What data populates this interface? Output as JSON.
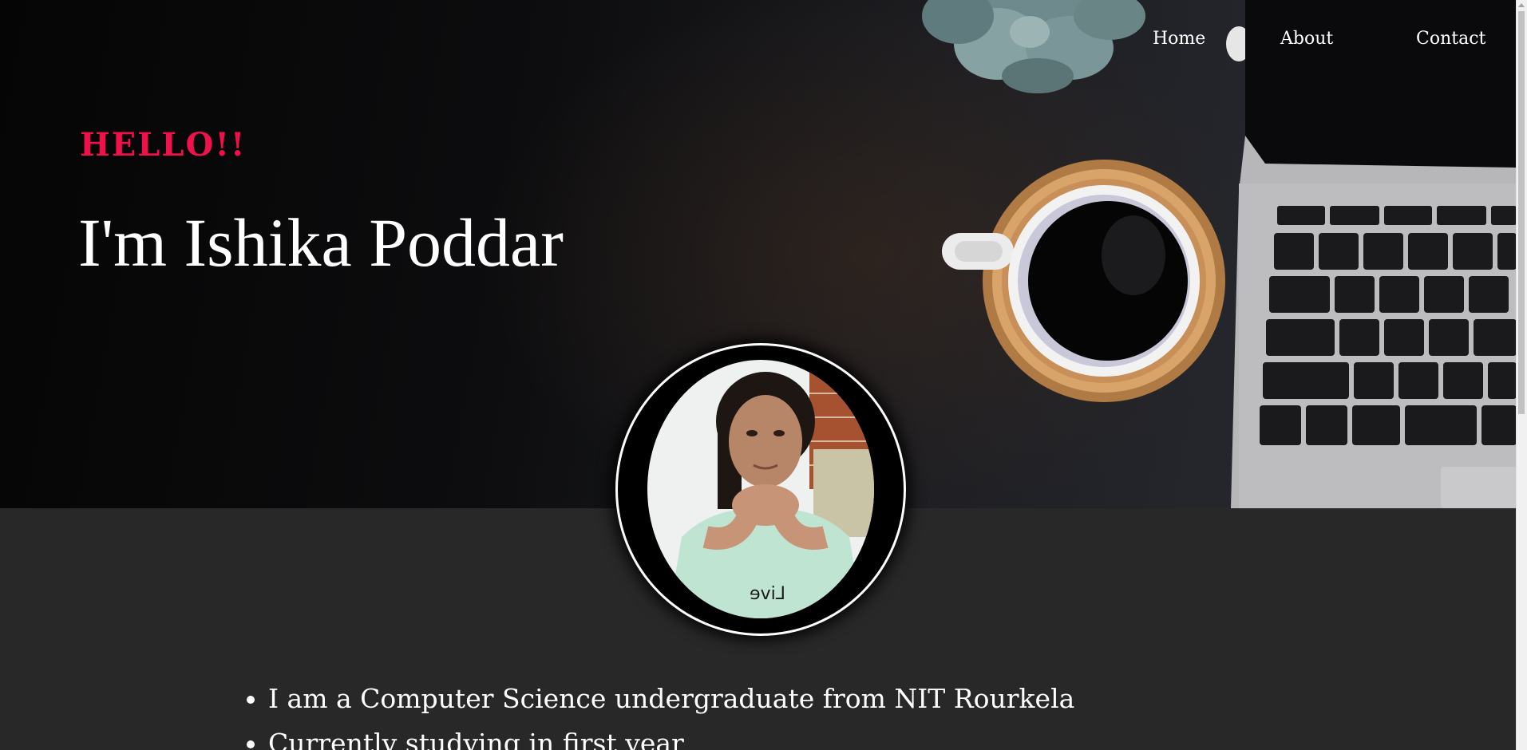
{
  "nav": {
    "home": "Home",
    "about": "About",
    "contact": "Contact"
  },
  "hero": {
    "greeting": "HELLO!!",
    "name": "I'm Ishika Poddar"
  },
  "about": {
    "items": [
      "I am a Computer Science undergraduate from NIT Rourkela",
      "Currently studying in first year"
    ]
  },
  "colors": {
    "accent": "#f0104a",
    "background": "#282828",
    "text": "#ffffff"
  },
  "icons": {
    "avatar": "profile-photo"
  }
}
